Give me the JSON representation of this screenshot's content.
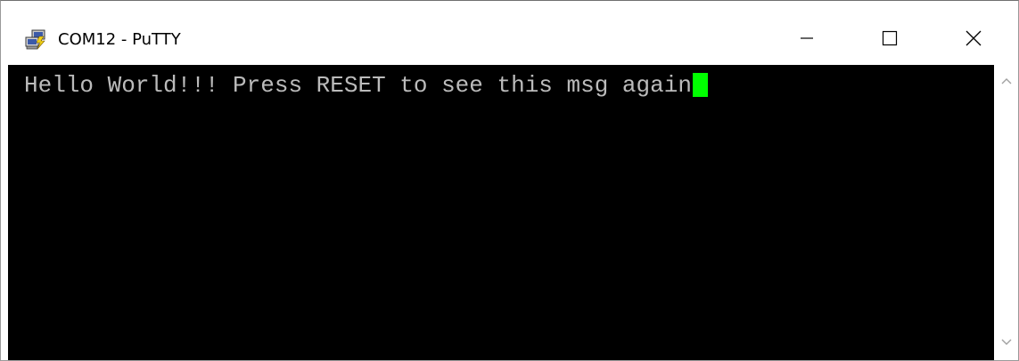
{
  "window": {
    "title": "COM12 - PuTTY",
    "icon": "putty-computers-lightning-icon",
    "controls": {
      "minimize_icon": "minimize-icon",
      "maximize_icon": "maximize-icon",
      "close_icon": "close-icon"
    }
  },
  "terminal": {
    "lines": [
      "Hello World!!! Press RESET to see this msg again"
    ],
    "background_color": "#000000",
    "text_color": "#bbbbbb",
    "cursor_color": "#00ff00"
  },
  "scrollbar": {
    "up_icon": "scroll-up-arrow-icon",
    "down_icon": "scroll-down-arrow-icon"
  }
}
